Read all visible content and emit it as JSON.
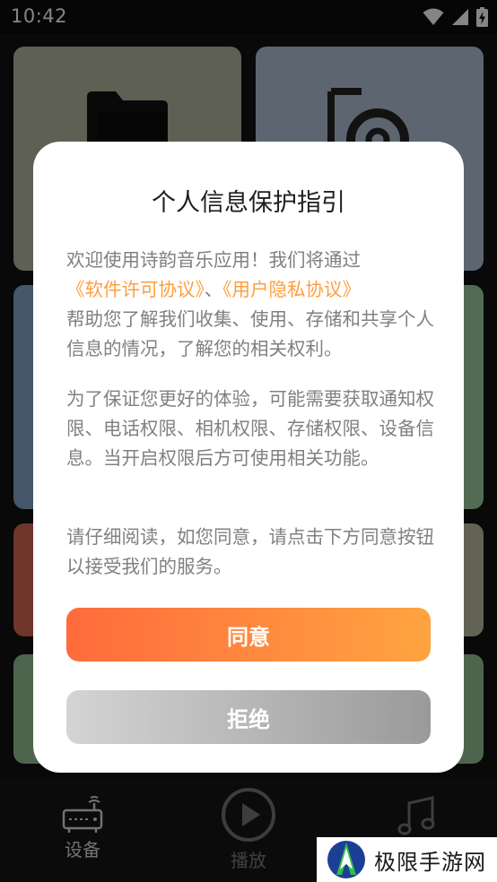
{
  "status_bar": {
    "time": "10:42",
    "icons": [
      "wifi-icon",
      "cell-signal-icon",
      "battery-charging-icon"
    ]
  },
  "bottom_nav": {
    "items": [
      {
        "label": "设备",
        "icon": "router-icon"
      },
      {
        "label": "播放",
        "icon": "play-circle-icon"
      },
      {
        "label": "",
        "icon": "music-note-icon"
      }
    ]
  },
  "dialog": {
    "title": "个人信息保护指引",
    "p1_text": "欢迎使用诗韵音乐应用！我们将通过",
    "p1_link_license": "《软件许可协议》",
    "p1_separator": "、",
    "p1_link_privacy": "《用户隐私协议》",
    "p1_tail": "帮助您了解我们收集、使用、存储和共享个人信息的情况，了解您的相关权利。",
    "p2": "为了保证您更好的体验，可能需要获取通知权限、电话权限、相机权限、存储权限、设备信息。当开启权限后方可使用相关功能。",
    "p3": "请仔细阅读，如您同意，请点击下方同意按钮以接受我们的服务。",
    "agree_label": "同意",
    "refuse_label": "拒绝"
  },
  "colors": {
    "link": "#ff9e3d",
    "agree_start": "#ff6b3c",
    "agree_end": "#ffa441",
    "refuse_start": "#d4d4d4",
    "refuse_end": "#9a9a9a"
  },
  "watermark": {
    "text": "极限手游网"
  }
}
